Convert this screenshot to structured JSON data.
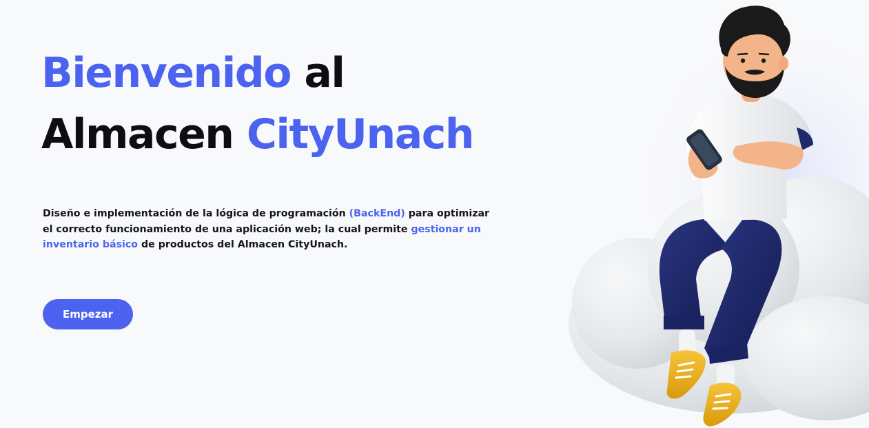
{
  "hero": {
    "title_line1_accent": "Bienvenido",
    "title_line1_rest": " al",
    "title_line2_rest": "Almacen ",
    "title_line2_accent": "CityUnach",
    "description": {
      "part1": "Diseño e implementación de la lógica de programación ",
      "link1": "(BackEnd)",
      "part2": " para optimizar el correcto funcionamiento de una aplicación web; la cual permite ",
      "link2": "gestionar un inventario básico",
      "part3": " de productos del Almacen CityUnach."
    },
    "cta_label": "Empezar"
  },
  "colors": {
    "accent": "#4b63ef",
    "text": "#0d0d12",
    "background": "#f8f9fb",
    "cloud": "#e8ecef",
    "pants": "#1e2a6b",
    "shirt": "#f1f2f4",
    "shoes": "#f2b61f",
    "skin": "#f4b48a",
    "hair": "#1a1a1a"
  },
  "illustration": {
    "icon": "man-sitting-on-cloud-with-phone-illustration"
  }
}
